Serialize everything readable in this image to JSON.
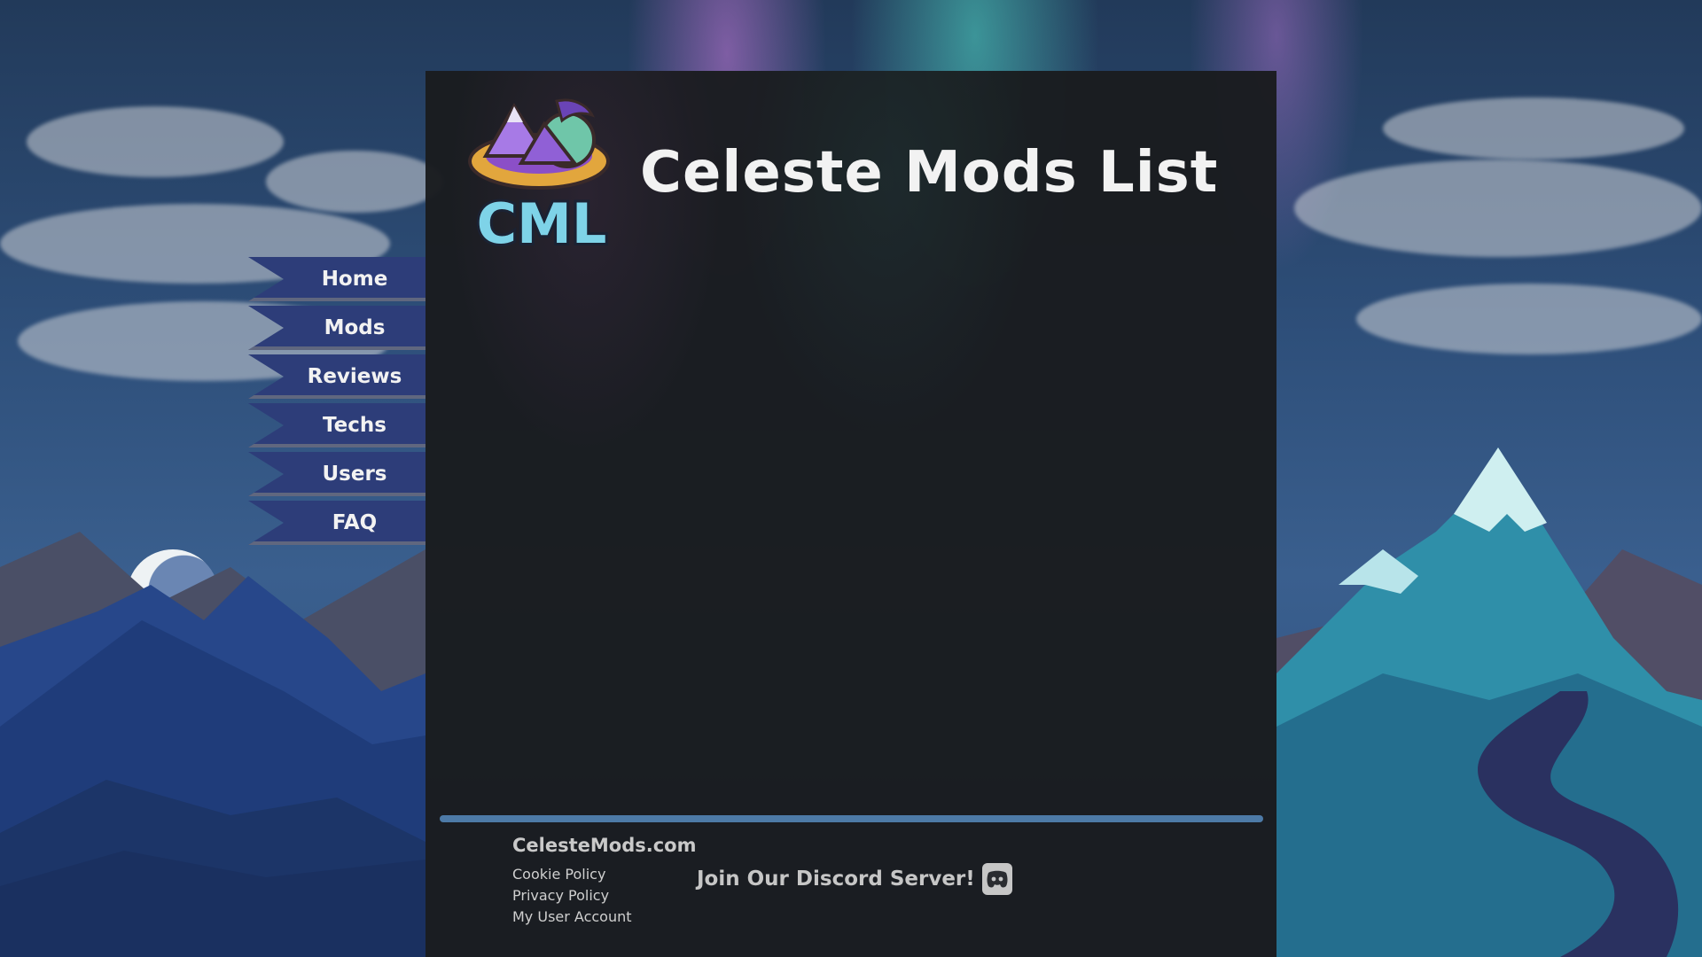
{
  "header": {
    "title": "Celeste Mods List",
    "logo_text": "CML"
  },
  "nav": {
    "items": [
      {
        "label": "Home"
      },
      {
        "label": "Mods"
      },
      {
        "label": "Reviews"
      },
      {
        "label": "Techs"
      },
      {
        "label": "Users"
      },
      {
        "label": "FAQ"
      }
    ]
  },
  "footer": {
    "site_name": "CelesteMods.com",
    "links": [
      {
        "label": "Cookie Policy"
      },
      {
        "label": "Privacy Policy"
      },
      {
        "label": "My User Account"
      }
    ],
    "discord_label": "Join Our Discord Server!",
    "discord_icon": "discord-icon"
  },
  "colors": {
    "panel": "#1a1c1f",
    "nav_ribbon": "#2d3d79",
    "footer_bar": "#4d7aa7",
    "title_text": "#f2f2f2"
  }
}
